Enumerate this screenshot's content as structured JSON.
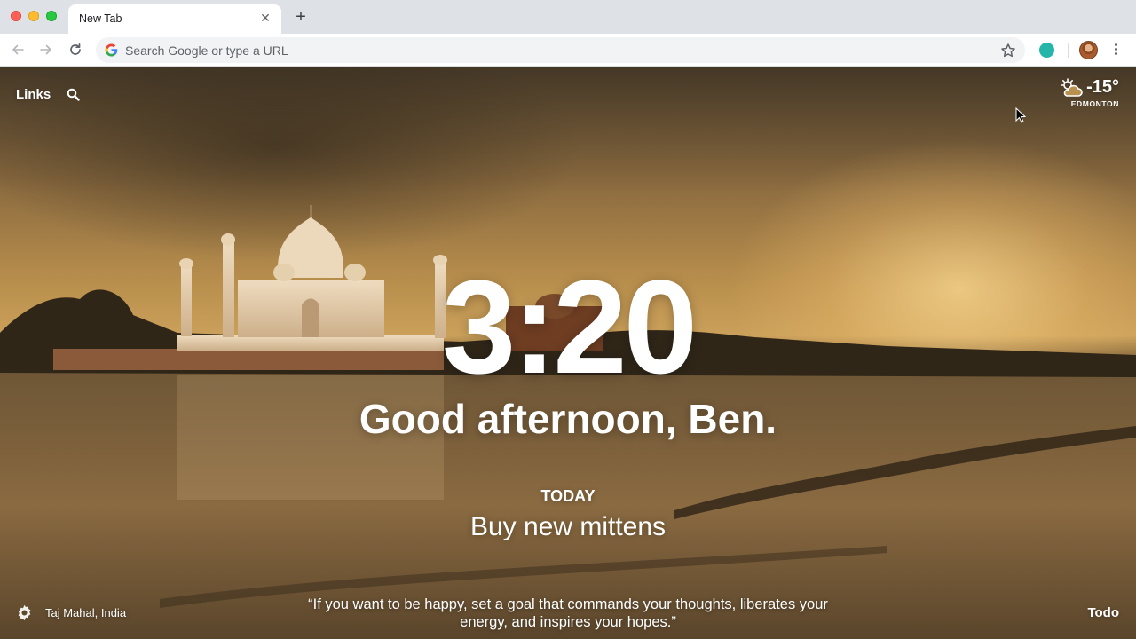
{
  "browser": {
    "tab_title": "New Tab",
    "tab_close": "✕",
    "new_tab": "+",
    "omnibox_placeholder": "Search Google or type a URL",
    "icons": [
      "back-arrow-icon",
      "forward-arrow-icon",
      "reload-icon",
      "google-icon",
      "star-icon",
      "extension-icon",
      "avatar",
      "menu-icon"
    ]
  },
  "dashboard": {
    "links_label": "Links",
    "weather": {
      "temp": "-15°",
      "location": "EDMONTON",
      "icon": "partly-cloudy-icon"
    },
    "clock": "3:20",
    "greeting": "Good afternoon, Ben.",
    "focus": {
      "label": "TODAY",
      "text": "Buy new mittens"
    },
    "photo_location": "Taj Mahal, India",
    "quote": "“If you want to be happy, set a goal that commands your thoughts, liberates your energy, and inspires your hopes.”",
    "todo_label": "Todo",
    "background": "Taj Mahal at sunset over the Yamuna river"
  },
  "colors": {
    "tabstrip": "#dee1e6",
    "omnibox": "#f1f3f4",
    "extension": "#26b5a9",
    "sky_warm": "#caa05a"
  }
}
